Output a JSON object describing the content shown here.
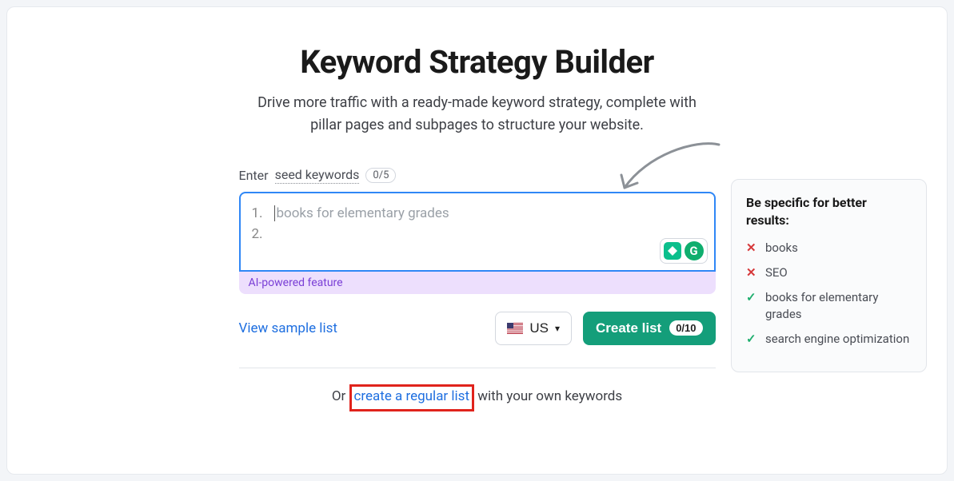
{
  "header": {
    "title": "Keyword Strategy Builder",
    "subtitle": "Drive more traffic with a ready-made keyword strategy, complete with pillar pages and subpages to structure your website."
  },
  "seed": {
    "label_prefix": "Enter ",
    "label_dotted": "seed keywords",
    "count": "0/5",
    "placeholder": "books for elementary grades",
    "ai_label": "AI-powered feature"
  },
  "controls": {
    "sample_link": "View sample list",
    "country": "US",
    "create_label": "Create list",
    "create_count": "0/10"
  },
  "bottom": {
    "prefix": "Or ",
    "link": "create a regular list",
    "suffix": " with your own keywords"
  },
  "tips": {
    "title": "Be specific for better results:",
    "bad": [
      "books",
      "SEO"
    ],
    "good": [
      "books for elementary grades",
      "search engine optimization"
    ]
  }
}
